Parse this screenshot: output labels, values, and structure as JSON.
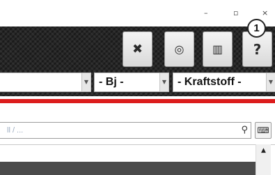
{
  "window": {
    "minimize_glyph": "–",
    "maximize_glyph": "▫",
    "close_glyph": "×"
  },
  "callout": {
    "number": "1"
  },
  "toolbar": {
    "buttons": [
      {
        "icon": "tools-icon",
        "glyph": "✖"
      },
      {
        "icon": "tire-icon",
        "glyph": "◎"
      },
      {
        "icon": "gift-icon",
        "glyph": "▥"
      },
      {
        "icon": "help-icon",
        "glyph": "?"
      }
    ]
  },
  "filters": {
    "first": {
      "value": ""
    },
    "year": {
      "value": "- Bj -"
    },
    "fuel": {
      "value": "- Kraftstoff -"
    }
  },
  "search": {
    "placeholder": "ll / ...",
    "search_glyph": "⚲",
    "keyboard_glyph": "⌨"
  },
  "list": {
    "scroll_up_glyph": "▲"
  },
  "colors": {
    "accent_red": "#dc1c1c",
    "toolbar_dark": "#262626",
    "placeholder": "#9aaabf"
  }
}
